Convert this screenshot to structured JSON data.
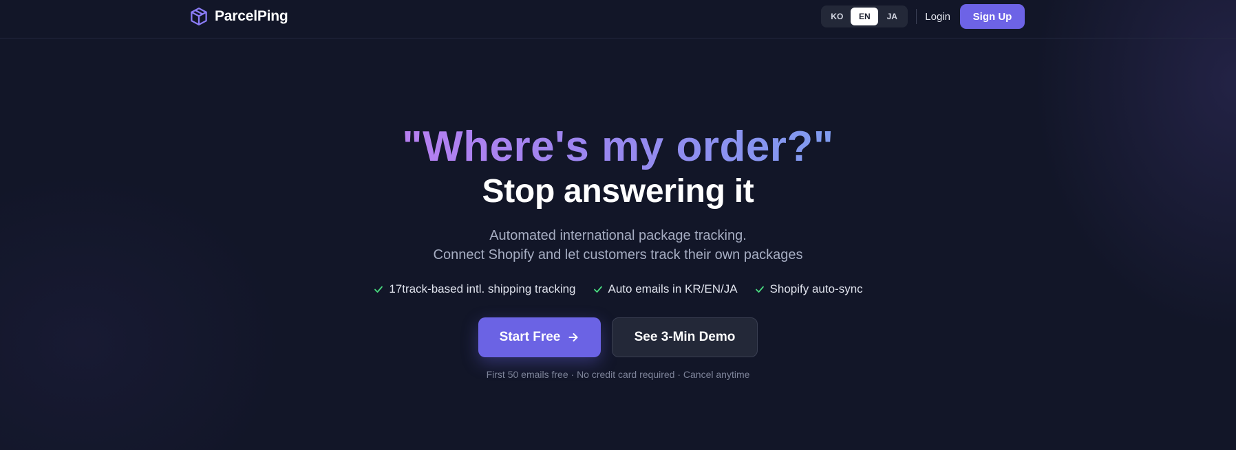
{
  "colors": {
    "background": "#121628",
    "accent": "#6b63e4",
    "gradient_start": "#b77ff0",
    "gradient_end": "#7f9cf0",
    "check": "#4ade80"
  },
  "navbar": {
    "brand_name": "ParcelPing",
    "brand_icon": "package-box-icon",
    "languages": [
      {
        "code": "KO",
        "active": false
      },
      {
        "code": "EN",
        "active": true
      },
      {
        "code": "JA",
        "active": false
      }
    ],
    "login_label": "Login",
    "signup_label": "Sign Up"
  },
  "hero": {
    "headline_quote": "\"Where's my order?\"",
    "headline_sub": "Stop answering it",
    "description_line1": "Automated international package tracking.",
    "description_line2": "Connect Shopify and let customers track their own packages",
    "features": [
      {
        "icon": "check-icon",
        "label": "17track-based intl. shipping tracking"
      },
      {
        "icon": "check-icon",
        "label": "Auto emails in KR/EN/JA"
      },
      {
        "icon": "check-icon",
        "label": "Shopify auto-sync"
      }
    ],
    "primary_cta": "Start Free",
    "primary_cta_icon": "arrow-right-icon",
    "secondary_cta": "See 3-Min Demo",
    "fineprint": "First 50 emails free · No credit card required · Cancel anytime"
  }
}
